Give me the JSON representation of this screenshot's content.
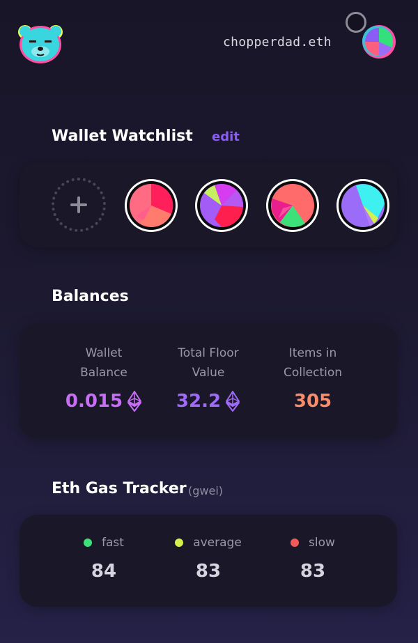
{
  "header": {
    "logo_icon": "bear-mascot-icon",
    "username": "chopperdad.eth",
    "avatar_icon": "user-avatar-icon"
  },
  "watchlist": {
    "title": "Wallet Watchlist",
    "edit_label": "edit",
    "add_icon": "plus-icon",
    "wallets": [
      {
        "icon": "wallet-avatar-icon"
      },
      {
        "icon": "wallet-avatar-icon"
      },
      {
        "icon": "wallet-avatar-icon"
      },
      {
        "icon": "wallet-avatar-icon"
      }
    ]
  },
  "balances": {
    "title": "Balances",
    "stats": [
      {
        "label_line1": "Wallet",
        "label_line2": "Balance",
        "value": "0.015",
        "color": "#c86df5",
        "icon": "ethereum-icon"
      },
      {
        "label_line1": "Total Floor",
        "label_line2": "Value",
        "value": "32.2",
        "color": "#9f6bf6",
        "icon": "ethereum-icon"
      },
      {
        "label_line1": "Items in",
        "label_line2": "Collection",
        "value": "305",
        "color": "#f98d6b"
      }
    ]
  },
  "gas": {
    "title": "Eth Gas Tracker",
    "unit": "(gwei)",
    "items": [
      {
        "label": "fast",
        "value": "84",
        "color": "#3ee07a"
      },
      {
        "label": "average",
        "value": "83",
        "color": "#d4f04a"
      },
      {
        "label": "slow",
        "value": "83",
        "color": "#f25a5a"
      }
    ]
  }
}
